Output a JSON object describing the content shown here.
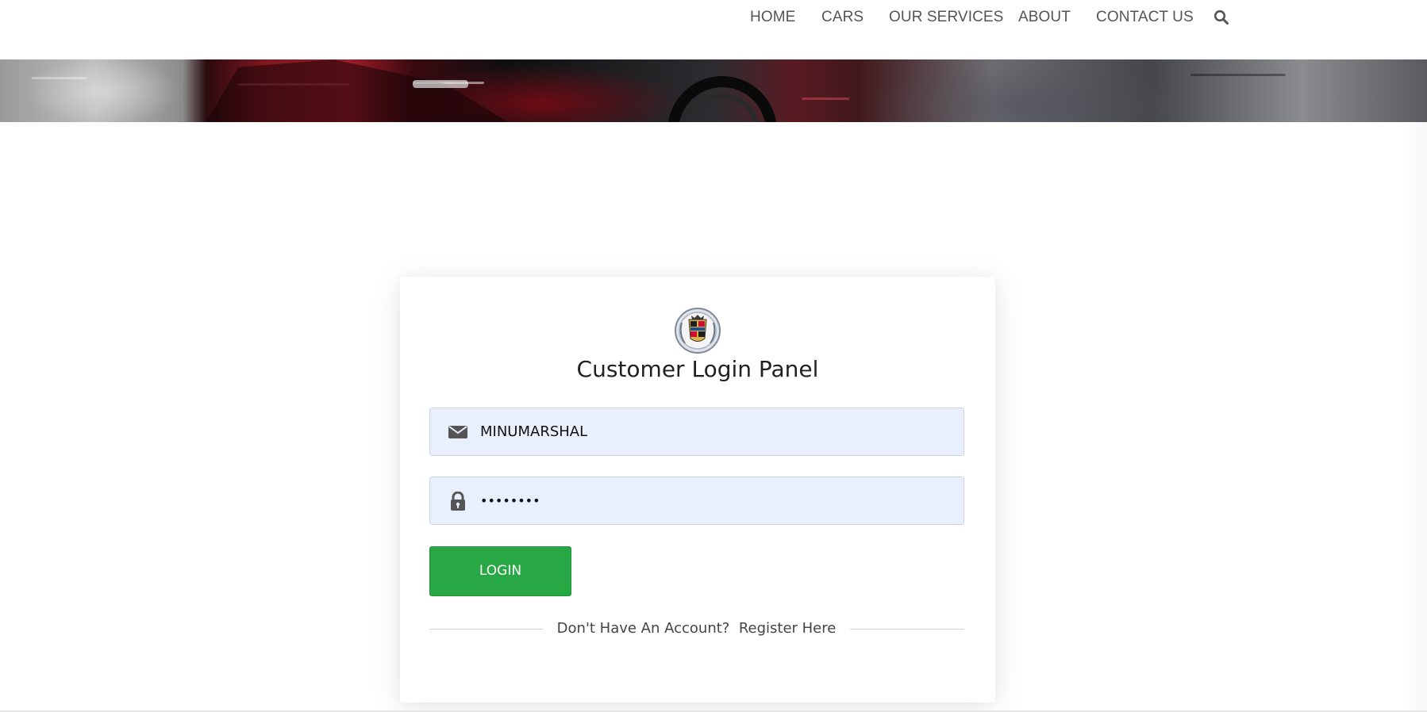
{
  "nav": {
    "items": [
      {
        "label": "HOME"
      },
      {
        "label": "CARS"
      },
      {
        "label": "OUR SERVICES"
      },
      {
        "label": "ABOUT"
      },
      {
        "label": "CONTACT US"
      }
    ],
    "search_icon": "search-icon"
  },
  "login": {
    "title": "Customer Login Panel",
    "logo_icon": "cadillac-crest-logo",
    "username": {
      "icon": "envelope-icon",
      "value": "MINUMARSHAL"
    },
    "password": {
      "icon": "lock-icon",
      "value": "••••••••"
    },
    "button_label": "LOGIN",
    "register_prompt": "Don't Have An Account?",
    "register_link": "Register Here"
  },
  "colors": {
    "login_button": "#28a745",
    "input_background": "#e8f0fe",
    "nav_text": "#555555"
  }
}
